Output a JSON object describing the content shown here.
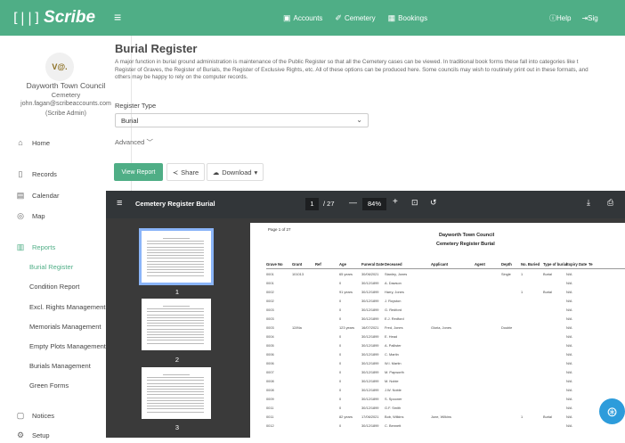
{
  "app": {
    "logo_mark": "[||]",
    "logo_text": "Scribe"
  },
  "topnav": {
    "items": [
      {
        "label": "Accounts",
        "icon": "▣"
      },
      {
        "label": "Cemetery",
        "icon": "✐"
      },
      {
        "label": "Bookings",
        "icon": "▦"
      }
    ],
    "help_label": "Help",
    "signout_label": "Sig"
  },
  "sidebar": {
    "avatar_text": "V@.",
    "org_name": "Dayworth Town Council",
    "org_sub": "Cemetery",
    "user_email": "john.fagan@scribeaccounts.com",
    "user_role": "(Scribe Admin)",
    "items": [
      {
        "label": "Home",
        "icon": "⌂"
      },
      {
        "label": "Records",
        "icon": "▯"
      },
      {
        "label": "Calendar",
        "icon": "▤"
      },
      {
        "label": "Map",
        "icon": "◎"
      },
      {
        "label": "Reports",
        "icon": "▥"
      },
      {
        "label": "Notices",
        "icon": "▢"
      },
      {
        "label": "Setup",
        "icon": "⚙"
      }
    ],
    "report_items": [
      "Burial Register",
      "Condition Report",
      "Excl. Rights Management",
      "Memorials Management",
      "Empty Plots Management",
      "Burials Management",
      "Green Forms"
    ]
  },
  "main": {
    "title": "Burial Register",
    "description_lines": [
      "A major function in burial ground administration is maintenance of the Public Register so that all the Cemetery cases can be viewed. In traditional book forms these fall into categories like t",
      "Register of Graves, the Register of Burials, the Register of Exclusive Rights, etc. All of these options can be produced here. Some councils may wish to routinely print out in these formats, and",
      "others may be happy to rely on the computer records."
    ],
    "register_type_label": "Register Type",
    "register_type_value": "Burial",
    "advanced_label": "Advanced",
    "view_report_label": "View Report",
    "share_label": "Share",
    "download_label": "Download"
  },
  "viewer": {
    "title": "Cemetery Register Burial",
    "current_page": "1",
    "total_pages": "/ 27",
    "zoom": "84%",
    "thumbnails": [
      "1",
      "2",
      "3"
    ]
  },
  "pdf": {
    "page_of": "Page 1 of 27",
    "org": "Dayworth Town Council",
    "title": "Cemetery Register Burial",
    "columns": [
      "Grave No",
      "Grant",
      "Ref",
      "Age",
      "Funeral Date",
      "Deceased",
      "Applicant",
      "Agent",
      "Depth",
      "No. Buried",
      "Type of burial",
      "Expiry Date",
      "Te"
    ],
    "rows": [
      [
        "0001",
        "101013",
        "",
        "65 years",
        "30/06/2021",
        "Stanley, Jones",
        "",
        "",
        "Single",
        "1",
        "Burial",
        "N/A",
        ""
      ],
      [
        "0001",
        "",
        "",
        "0",
        "30/12/1899",
        "A. Dawson",
        "",
        "",
        "",
        "",
        "",
        "N/A",
        ""
      ],
      [
        "0002",
        "",
        "",
        "91 years",
        "30/12/1899",
        "Harry, Jones",
        "",
        "",
        "",
        "1",
        "Burial",
        "N/A",
        ""
      ],
      [
        "0002",
        "",
        "",
        "0",
        "30/12/1899",
        "J. Royston",
        "",
        "",
        "",
        "",
        "",
        "N/A",
        ""
      ],
      [
        "0003",
        "",
        "",
        "0",
        "30/12/1899",
        "G. Redford",
        "",
        "",
        "",
        "",
        "",
        "N/A",
        ""
      ],
      [
        "0003",
        "",
        "",
        "0",
        "30/12/1899",
        "E.J. Redford",
        "",
        "",
        "",
        "",
        "",
        "N/A",
        ""
      ],
      [
        "0003",
        "12/Ma",
        "",
        "123 years",
        "16/07/2021",
        "Fred, Jones",
        "Gloria, Jones",
        "",
        "Double",
        "",
        "",
        "N/A",
        ""
      ],
      [
        "0004",
        "",
        "",
        "0",
        "30/12/1899",
        "E. Head",
        "",
        "",
        "",
        "",
        "",
        "N/A",
        ""
      ],
      [
        "0005",
        "",
        "",
        "0",
        "30/12/1899",
        "A. Pallister",
        "",
        "",
        "",
        "",
        "",
        "N/A",
        ""
      ],
      [
        "0006",
        "",
        "",
        "0",
        "30/12/1899",
        "C. Martin",
        "",
        "",
        "",
        "",
        "",
        "N/A",
        ""
      ],
      [
        "0006",
        "",
        "",
        "0",
        "30/12/1899",
        "W.I. Martin",
        "",
        "",
        "",
        "",
        "",
        "N/A",
        ""
      ],
      [
        "0007",
        "",
        "",
        "0",
        "30/12/1899",
        "M. Papworth",
        "",
        "",
        "",
        "",
        "",
        "N/A",
        ""
      ],
      [
        "0008",
        "",
        "",
        "0",
        "30/12/1899",
        "M. Noble",
        "",
        "",
        "",
        "",
        "",
        "N/A",
        ""
      ],
      [
        "0008",
        "",
        "",
        "0",
        "30/12/1899",
        "J.W. Noble",
        "",
        "",
        "",
        "",
        "",
        "N/A",
        ""
      ],
      [
        "0009",
        "",
        "",
        "0",
        "30/12/1899",
        "S. Spooner",
        "",
        "",
        "",
        "",
        "",
        "N/A",
        ""
      ],
      [
        "0011",
        "",
        "",
        "0",
        "30/12/1899",
        "G.F. Smith",
        "",
        "",
        "",
        "",
        "",
        "N/A",
        ""
      ],
      [
        "0011",
        "",
        "",
        "82 years",
        "17/06/2021",
        "Bob, Wilkins",
        "June, Wilkins",
        "",
        "",
        "1",
        "Burial",
        "N/A",
        ""
      ],
      [
        "0012",
        "",
        "",
        "0",
        "30/12/1899",
        "C. Bennett",
        "",
        "",
        "",
        "",
        "",
        "N/A",
        ""
      ]
    ]
  }
}
